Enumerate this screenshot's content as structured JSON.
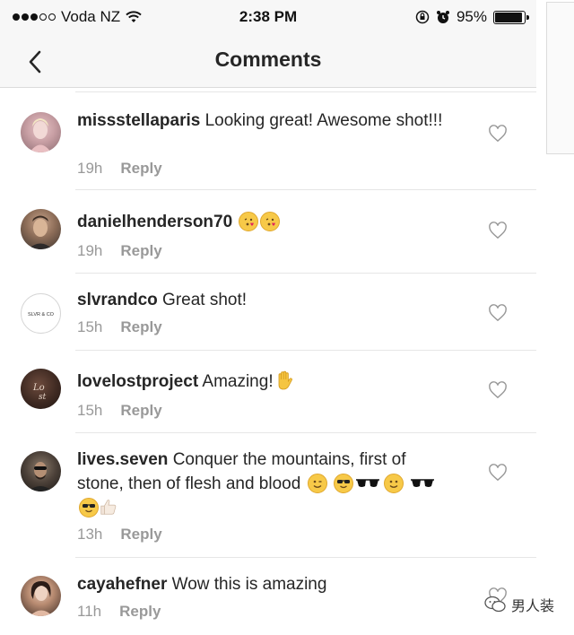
{
  "status_bar": {
    "carrier": "Voda NZ",
    "time": "2:38 PM",
    "battery": "95%",
    "battery_level": 0.95
  },
  "nav": {
    "title": "Comments"
  },
  "comments": [
    {
      "username": "missstellaparis",
      "text": "Looking great! Awesome shot!!!",
      "time": "19h",
      "reply": "Reply"
    },
    {
      "username": "danielhenderson70",
      "text": "",
      "emoji": [
        "kissing-heart-emoji",
        "kissing-heart-emoji"
      ],
      "time": "19h",
      "reply": "Reply"
    },
    {
      "username": "slvrandco",
      "text": "Great shot!",
      "avatar_text": "SLVR & CO",
      "time": "15h",
      "reply": "Reply"
    },
    {
      "username": "lovelostproject",
      "text": "Amazing!",
      "emoji": [
        "raised-hand-emoji"
      ],
      "time": "15h",
      "reply": "Reply"
    },
    {
      "username": "lives.seven",
      "text": "Conquer the mountains, first of stone, then of flesh and blood",
      "emoji": [
        "winking-emoji",
        "sunglasses-face-emoji",
        "sunglasses-emoji",
        "smiling-emoji",
        "sunglasses-emoji",
        "sunglasses-face-emoji",
        "thumbs-up-emoji"
      ],
      "time": "13h",
      "reply": "Reply"
    },
    {
      "username": "cayahefner",
      "text": "Wow this is amazing",
      "time": "11h",
      "reply": "Reply"
    }
  ],
  "watermark": "男人装",
  "colors": {
    "bar_bg": "#f7f7f7",
    "meta_text": "#999999",
    "divider": "#e6e6e6"
  }
}
